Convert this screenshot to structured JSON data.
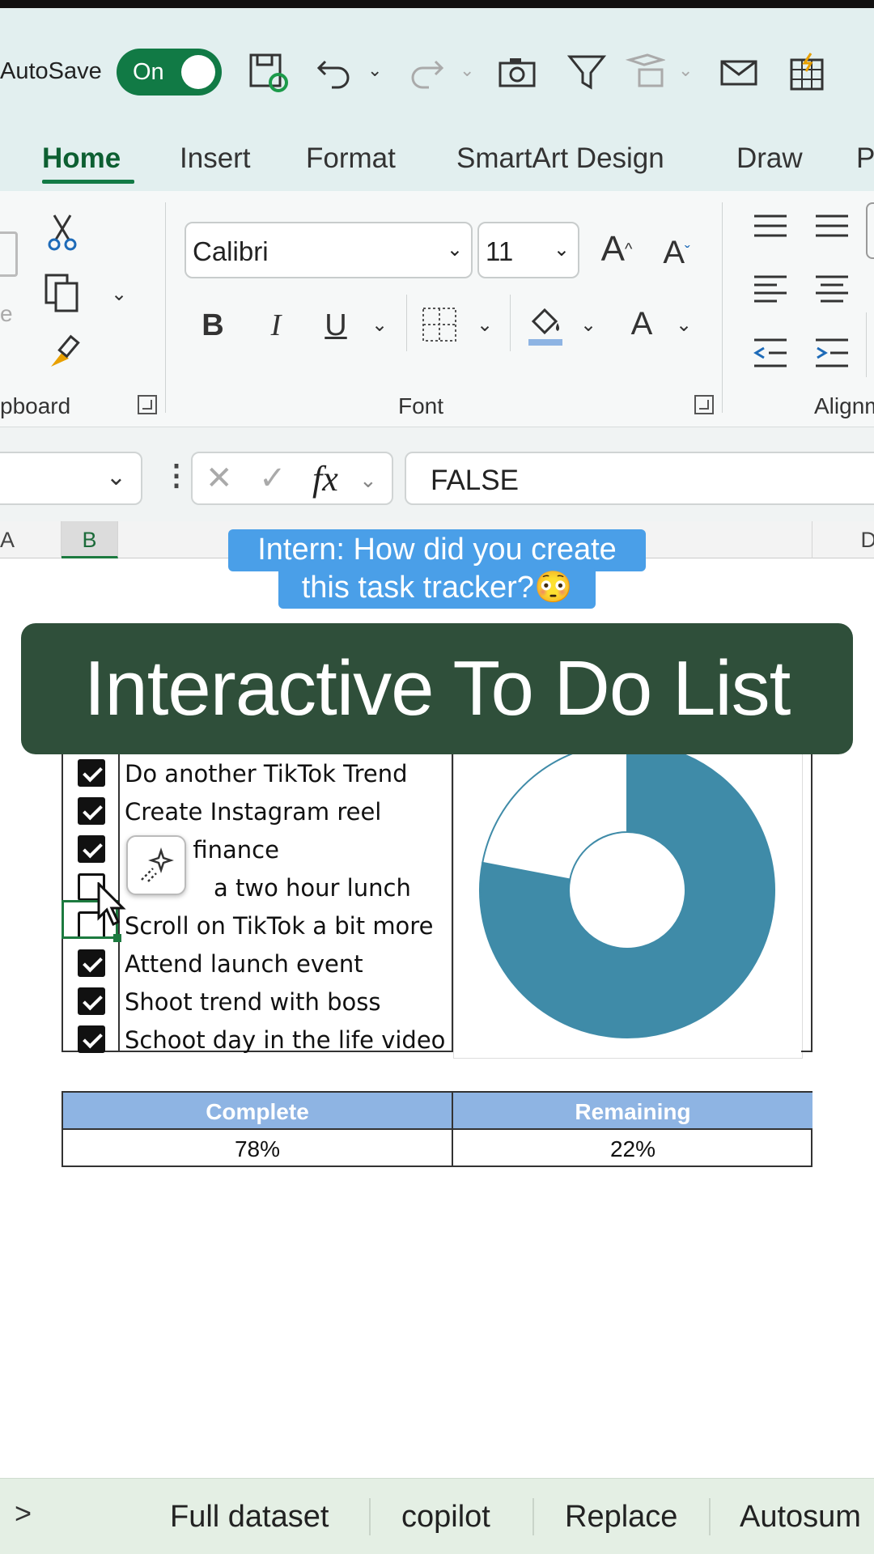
{
  "quick_access": {
    "autosave_label": "AutoSave",
    "toggle_label": "On",
    "icons": [
      "save-sync-icon",
      "undo-icon",
      "redo-icon",
      "camera-icon",
      "filter-icon",
      "form-icon",
      "envelope-icon",
      "table-lightning-icon"
    ]
  },
  "tabs": [
    "Home",
    "Insert",
    "Format",
    "SmartArt Design",
    "Draw",
    "P"
  ],
  "ribbon": {
    "clipboard_label": "pboard",
    "font_label": "Font",
    "alignment_label": "Alignm",
    "font_name": "Calibri",
    "font_size": "11"
  },
  "formula_bar": {
    "fx_label": "fx",
    "content": "FALSE"
  },
  "columns": [
    "A",
    "B",
    "D"
  ],
  "caption": {
    "line1": "Intern: How did you create",
    "line2": "this task tracker?😳"
  },
  "title": "Interactive To Do List",
  "tasks": [
    {
      "text": "Do another TikTok Trend",
      "checked": true
    },
    {
      "text": "Create Instagram reel",
      "checked": true
    },
    {
      "text": "y finance",
      "checked": true
    },
    {
      "text": "a two hour lunch",
      "checked": false
    },
    {
      "text": "Scroll on TikTok a bit more",
      "checked": false
    },
    {
      "text": "Attend launch event",
      "checked": true
    },
    {
      "text": "Shoot trend with boss",
      "checked": true
    },
    {
      "text": "Schoot day in the life video",
      "checked": true
    }
  ],
  "chart_data": {
    "type": "pie",
    "variant": "donut",
    "categories": [
      "Complete",
      "Remaining"
    ],
    "values": [
      78,
      22
    ],
    "colors": [
      "#3f8ba8",
      "#ffffff"
    ]
  },
  "summary": {
    "headers": [
      "Complete",
      "Remaining"
    ],
    "values": [
      "78%",
      "22%"
    ]
  },
  "suggestions": [
    "Full dataset",
    "copilot",
    "Replace",
    "Autosum"
  ]
}
